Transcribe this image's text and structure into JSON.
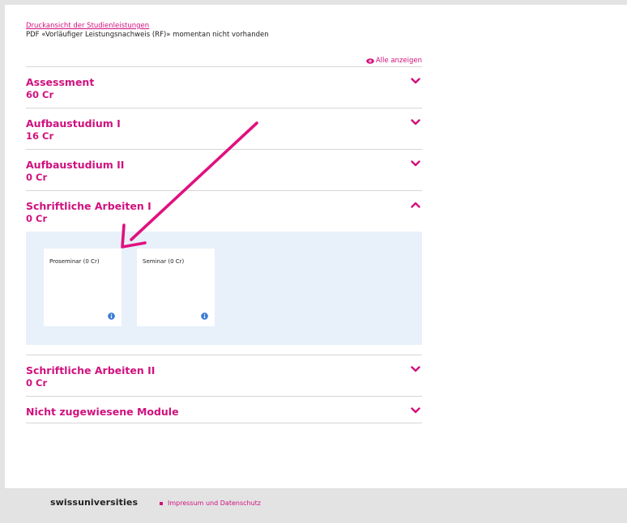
{
  "header": {
    "print_link": "Druckansicht der Studienleistungen",
    "pdf_note": "PDF «Vorläufiger Leistungsnachweis (RF)» momentan nicht vorhanden",
    "show_all": "Alle anzeigen"
  },
  "accordion": [
    {
      "title": "Assessment",
      "credits": "60 Cr",
      "expanded": false
    },
    {
      "title": "Aufbaustudium I",
      "credits": "16 Cr",
      "expanded": false
    },
    {
      "title": "Aufbaustudium II",
      "credits": "0 Cr",
      "expanded": false
    },
    {
      "title": "Schriftliche Arbeiten I",
      "credits": "0 Cr",
      "expanded": true,
      "modules": [
        {
          "label": "Proseminar (0 Cr)",
          "icon": "info-icon"
        },
        {
          "label": "Seminar (0 Cr)",
          "icon": "info-icon"
        }
      ]
    },
    {
      "title": "Schriftliche Arbeiten II",
      "credits": "0 Cr",
      "expanded": false
    },
    {
      "title": "Nicht zugewiesene Module",
      "expanded": false
    }
  ],
  "footer": {
    "logo": "swissuniversities",
    "link": "Impressum und Datenschutz"
  },
  "colors": {
    "accent": "#d0117e",
    "panel_bg": "#e8f0fa",
    "info_icon": "#3a7bd5"
  }
}
